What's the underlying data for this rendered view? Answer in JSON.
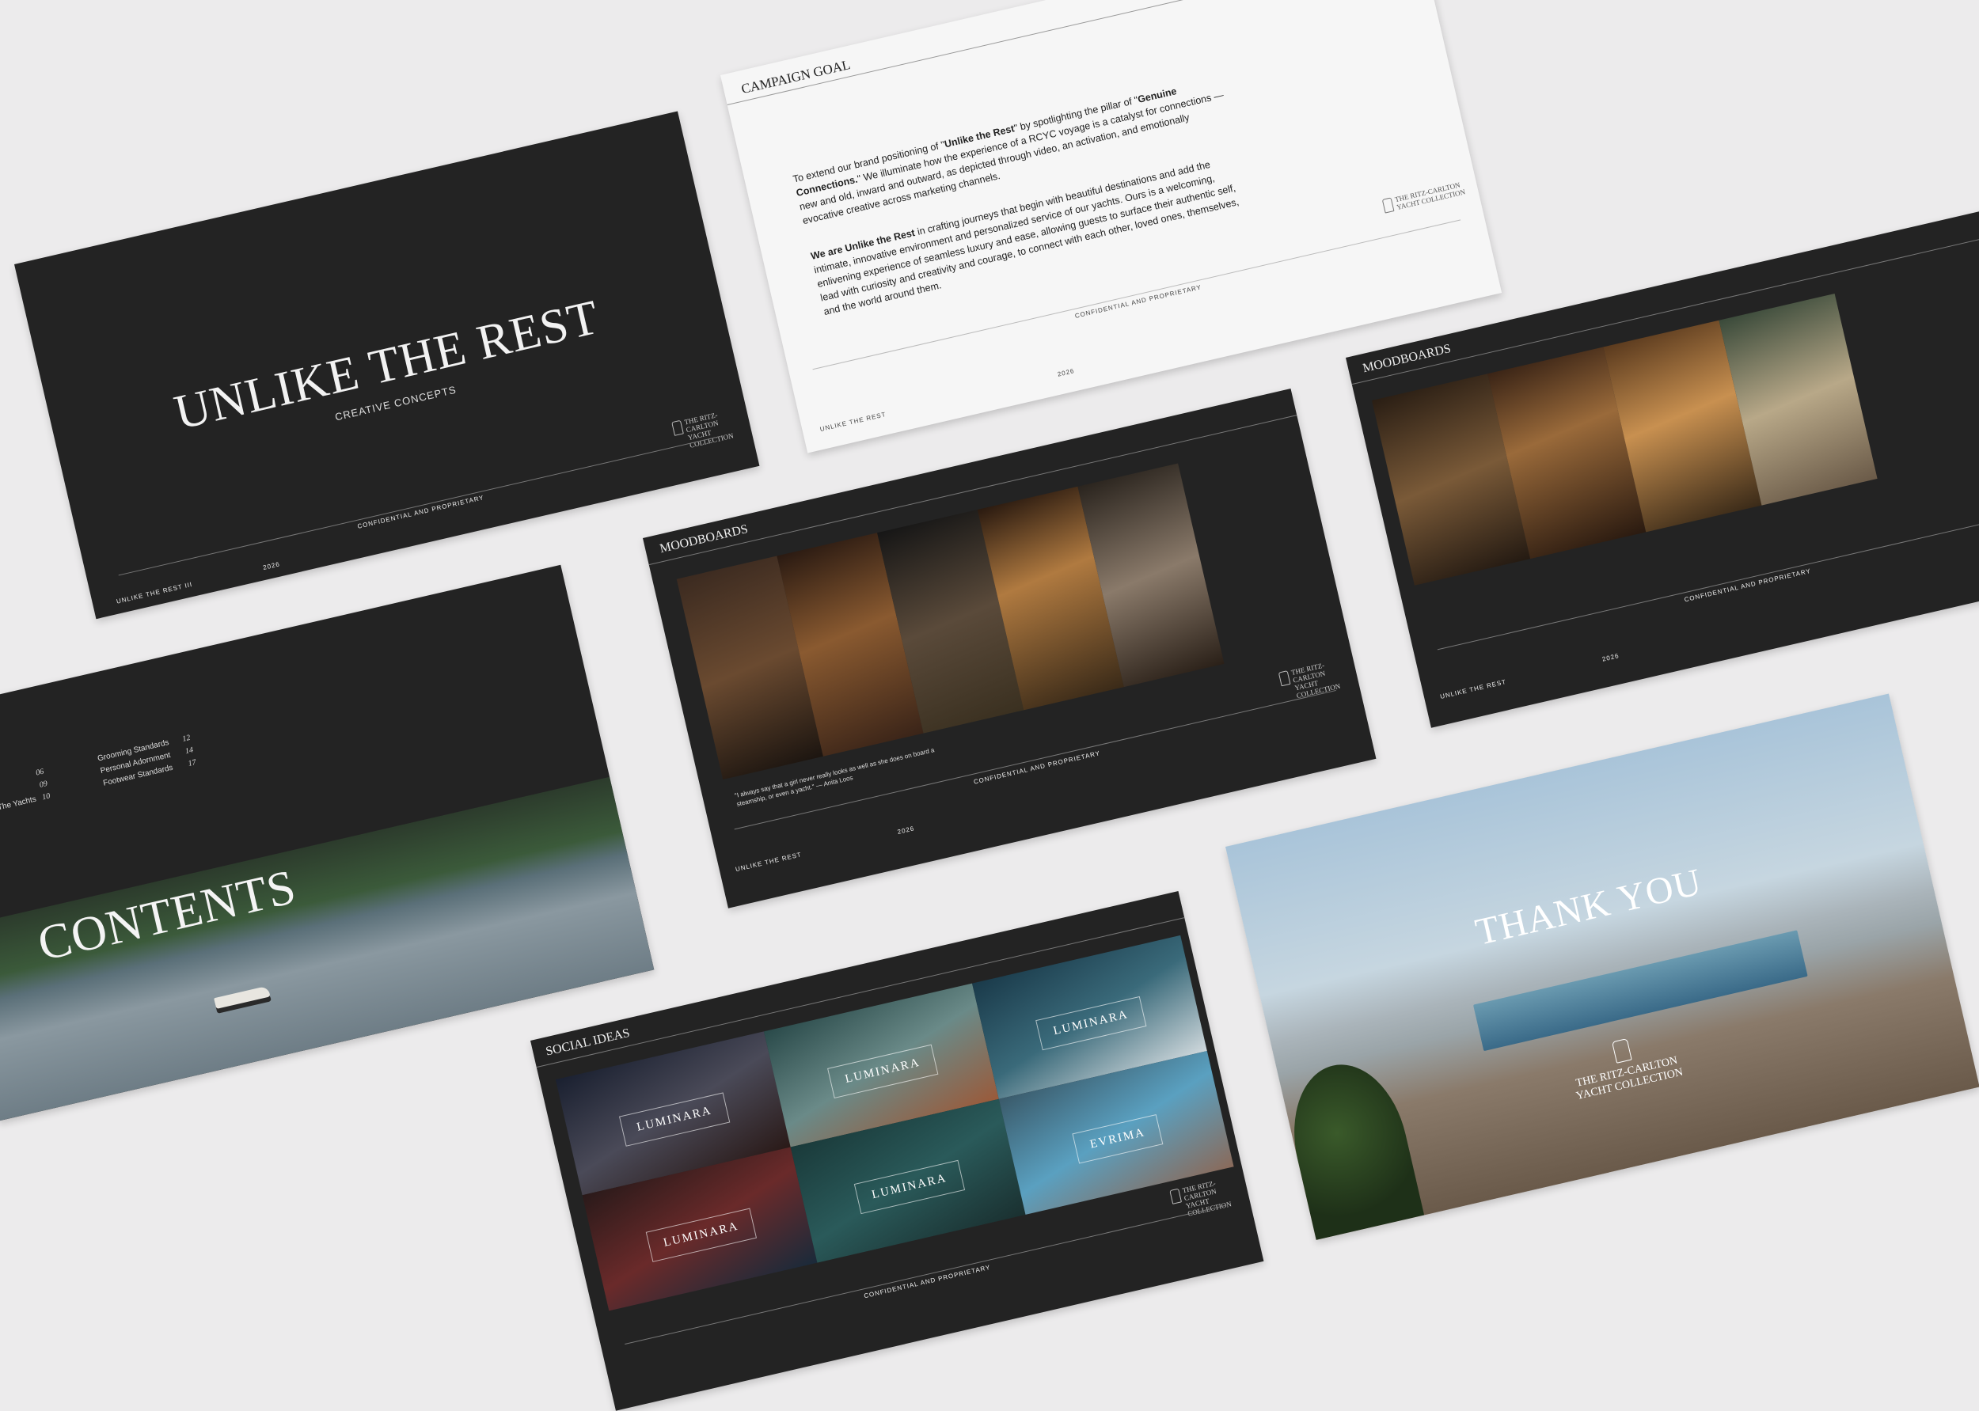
{
  "title_slide": {
    "title": "UNLIKE THE REST",
    "subtitle": "CREATIVE CONCEPTS",
    "footer_left": "UNLIKE THE REST III",
    "footer_year": "2026",
    "footer_conf": "CONFIDENTIAL AND PROPRIETARY",
    "logo_line1": "THE RITZ-CARLTON",
    "logo_line2": "YACHT COLLECTION"
  },
  "campaign_slide": {
    "heading": "CAMPAIGN GOAL",
    "para1_a": "To extend our brand positioning of \"",
    "para1_b": "Unlike the Rest",
    "para1_c": "\" by spotlighting the pillar of \"",
    "para1_d": "Genuine Connections.",
    "para1_e": "\" We illuminate how the experience of a RCYC voyage is a catalyst for connections — new and old, inward and outward, as depicted through video, an activation, and emotionally evocative creative across marketing channels.",
    "para2_a": "We are Unlike the Rest",
    "para2_b": " in crafting journeys that begin with beautiful destinations and add the intimate, innovative environment and personalized service of our yachts. Ours is a welcoming, enlivening experience of seamless luxury and ease, allowing guests to surface their authentic self, lead with curiosity and creativity and courage, to connect with each other, loved ones, themselves, and the world around them.",
    "footer_left": "UNLIKE THE REST",
    "footer_year": "2026",
    "footer_conf": "CONFIDENTIAL AND PROPRIETARY"
  },
  "contents_slide": {
    "heading": "CONTENTS",
    "left_items": [
      {
        "label": "s",
        "num": "06"
      },
      {
        "label": "",
        "num": "09"
      },
      {
        "label": "d The Yachts",
        "num": "10"
      }
    ],
    "right_items": [
      {
        "label": "Grooming Standards",
        "num": "12"
      },
      {
        "label": "Personal Adornment",
        "num": "14"
      },
      {
        "label": "Footwear Standards",
        "num": "17"
      }
    ]
  },
  "moodboard_center": {
    "heading": "MOODBOARDS",
    "quote": "\"I always say that a girl never really looks as well as she does on board a steamship, or even a yacht.\" — Anita Loos",
    "footer_left": "UNLIKE THE REST",
    "footer_year": "2026",
    "footer_conf": "CONFIDENTIAL AND PROPRIETARY",
    "logo_line1": "THE RITZ-CARLTON",
    "logo_line2": "YACHT COLLECTION"
  },
  "moodboard_right": {
    "heading": "MOODBOARDS",
    "footer_left": "UNLIKE THE REST",
    "footer_year": "2026",
    "footer_conf": "CONFIDENTIAL AND PROPRIETARY"
  },
  "social_slide": {
    "heading": "SOCIAL IDEAS",
    "tiles": [
      "LUMINARA",
      "LUMINARA",
      "LUMINARA",
      "LUMINARA",
      "EVRIMA",
      "LUMINARA"
    ],
    "footer_conf": "CONFIDENTIAL AND PROPRIETARY",
    "logo_line1": "THE RITZ-CARLTON",
    "logo_line2": "YACHT COLLECTION"
  },
  "thankyou_slide": {
    "title": "THANK YOU",
    "logo_line1": "THE RITZ-CARLTON",
    "logo_line2": "YACHT COLLECTION"
  },
  "colors": {
    "background": "#ecebec",
    "slide_dark": "#232323",
    "slide_light": "#f6f6f6"
  }
}
